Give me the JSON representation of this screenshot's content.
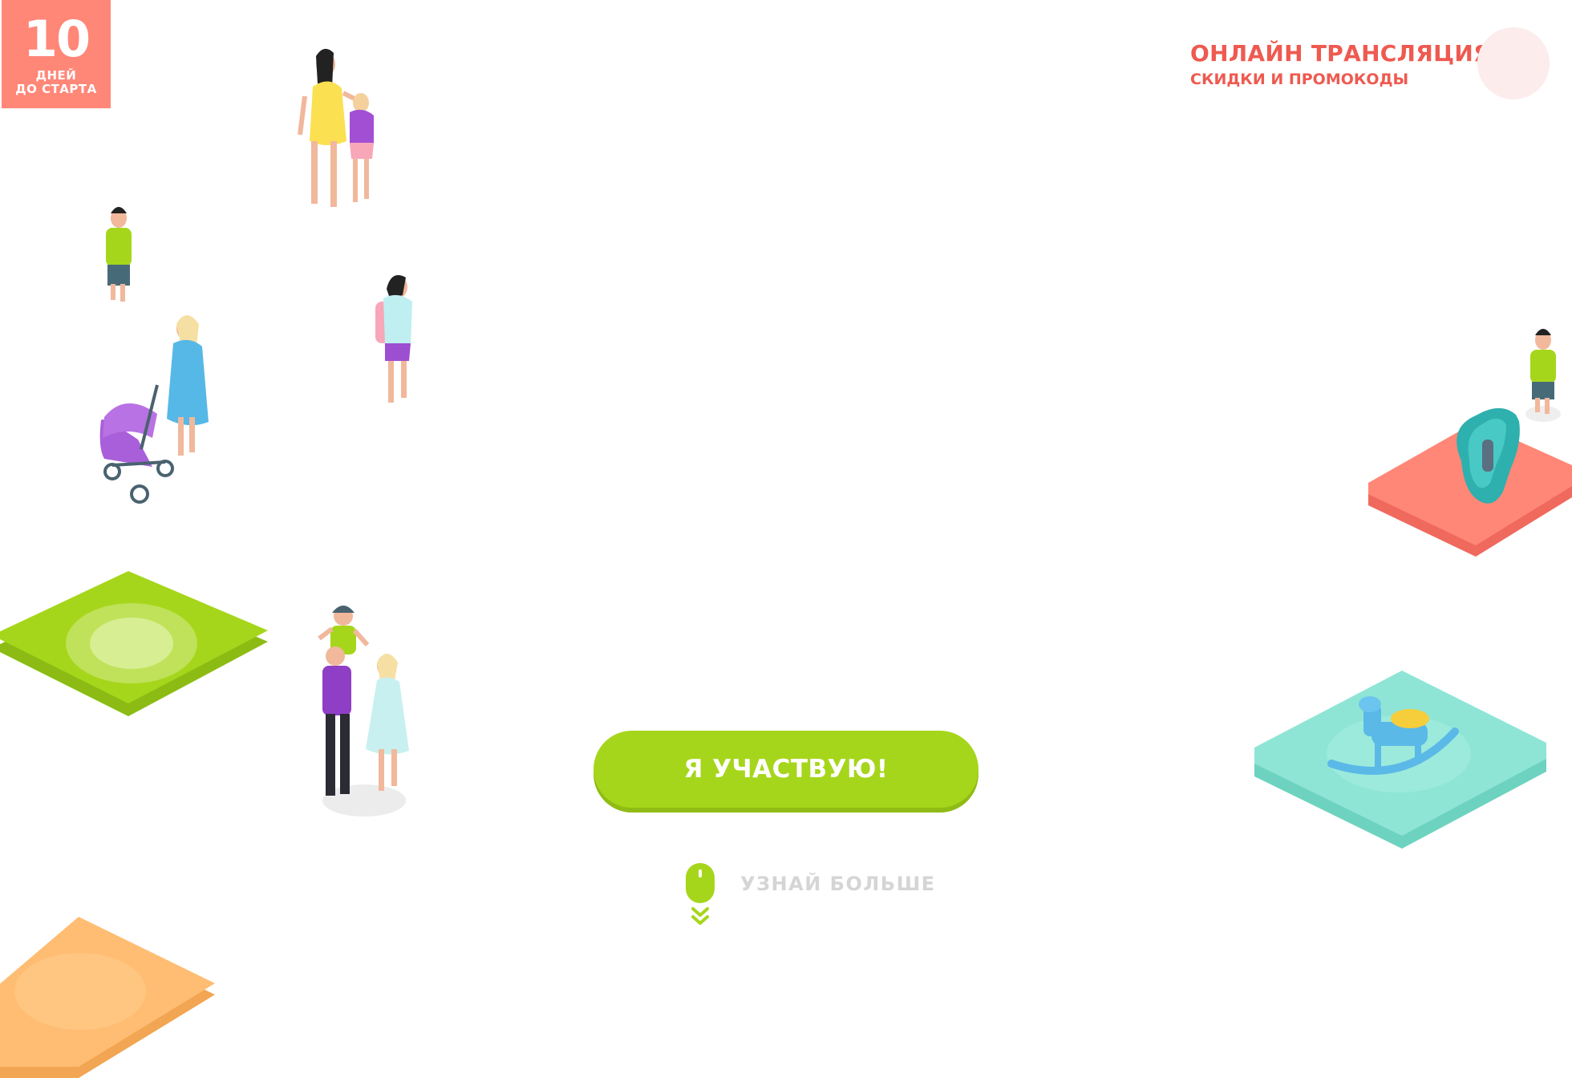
{
  "countdown": {
    "number": "10",
    "line1": "ДНЕЙ",
    "line2": "ДО СТАРТА"
  },
  "header": {
    "online_title": "ОНЛАЙН ТРАНСЛЯЦИЯ",
    "online_subtitle": "СКИДКИ И ПРОМОКОДЫ"
  },
  "cta": {
    "label": "Я УЧАСТВУЮ!"
  },
  "scroll_hint": {
    "label": "УЗНАЙ БОЛЬШЕ",
    "icon": "mouse-scroll-icon"
  },
  "colors": {
    "accent_green": "#a6d61b",
    "coral": "#ff8778",
    "title_red": "#ee5a50",
    "mint": "#8fe5d5",
    "orange": "#ffbd73",
    "muted_text": "#d5d5d5"
  }
}
